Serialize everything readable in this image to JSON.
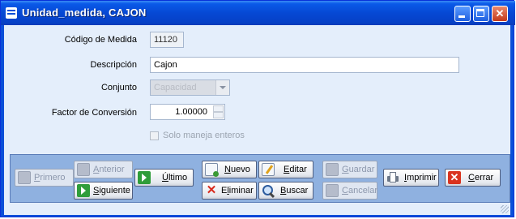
{
  "window": {
    "title": "Unidad_medida, CAJON"
  },
  "form": {
    "codigo_label": "Código de Medida",
    "codigo_value": "11120",
    "descripcion_label": "Descripción",
    "descripcion_value": "Cajon",
    "conjunto_label": "Conjunto",
    "conjunto_value": "Capacidad",
    "factor_label": "Factor de Conversión",
    "factor_value": "1.00000",
    "solo_enteros_label": "Solo maneja enteros",
    "solo_enteros_checked": false
  },
  "toolbar": {
    "primero": {
      "pre": "",
      "ul": "P",
      "post": "rimero"
    },
    "anterior": {
      "pre": "",
      "ul": "A",
      "post": "nterior"
    },
    "siguiente": {
      "pre": "",
      "ul": "S",
      "post": "iguiente"
    },
    "ultimo": {
      "pre": "",
      "ul": "Ú",
      "post": "ltimo"
    },
    "nuevo": {
      "pre": "",
      "ul": "N",
      "post": "uevo"
    },
    "editar": {
      "pre": "",
      "ul": "E",
      "post": "ditar"
    },
    "eliminar": {
      "pre": "E",
      "ul": "l",
      "post": "iminar"
    },
    "buscar": {
      "pre": "",
      "ul": "B",
      "post": "uscar"
    },
    "guardar": {
      "pre": "",
      "ul": "G",
      "post": "uardar"
    },
    "cancelar": {
      "pre": "",
      "ul": "C",
      "post": "ancelar"
    },
    "imprimir": {
      "pre": "",
      "ul": "I",
      "post": "mprimir"
    },
    "cerrar": {
      "pre": "",
      "ul": "C",
      "post": "errar"
    }
  },
  "icons": {
    "window_icon": "window-menu-icon",
    "minimize": "minimize-icon",
    "maximize": "maximize-icon",
    "close": "close-icon"
  },
  "colors": {
    "titlebar": "#0a4fd8",
    "client": "#e4eefb",
    "toolbar_panel": "#8fb1e0"
  }
}
